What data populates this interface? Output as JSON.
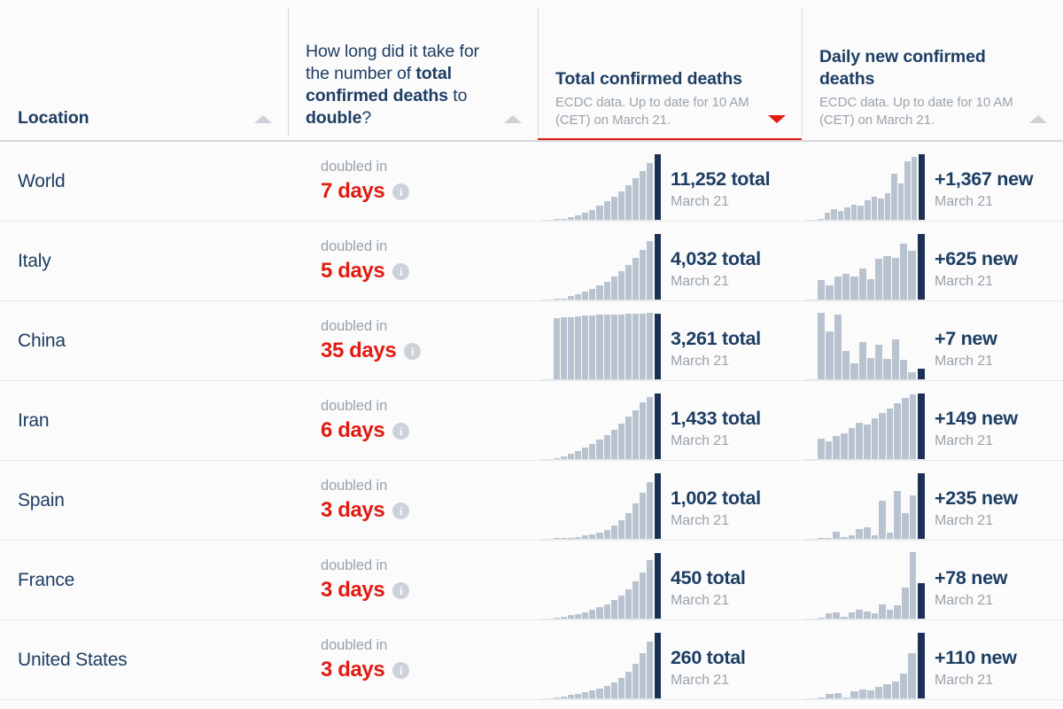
{
  "columns": {
    "location": {
      "label": "Location",
      "sort_icon": "triangle-up-icon",
      "sort_state": "inactive"
    },
    "doubling": {
      "title_parts": [
        "How long did it take for ",
        "the number of ",
        "total confirmed deaths",
        " to ",
        "double",
        "?"
      ],
      "title_plain": "How long did it take for the number of total confirmed deaths to double?",
      "sort_icon": "triangle-up-icon",
      "sort_state": "inactive"
    },
    "total_deaths": {
      "title": "Total confirmed deaths",
      "subtitle": "ECDC data. Up to date for 10 AM (CET) on March 21.",
      "sort_icon": "triangle-down-icon",
      "sort_state": "active-descending"
    },
    "daily_deaths": {
      "title": "Daily new confirmed deaths",
      "subtitle": "ECDC data. Up to date for 10 AM (CET) on March 21.",
      "sort_icon": "triangle-up-icon",
      "sort_state": "inactive"
    }
  },
  "labels": {
    "doubled_in": "doubled in",
    "info_glyph": "i"
  },
  "colors": {
    "accent_red": "#e01b12",
    "navy": "#1d3d63",
    "bar_light": "#b9c3cf",
    "bar_last": "#1d3154",
    "muted": "#9aa3ad",
    "background": "#fbfbfb"
  },
  "chart_data": {
    "type": "bar",
    "title": "Total confirmed deaths and Daily new confirmed deaths by location",
    "subtitle": "ECDC data. Up to date for 10 AM (CET) on March 21.",
    "xlabel": "",
    "ylabel": "",
    "legend": [],
    "grid": false,
    "note": "Each row contains two sparkline bar charts: cumulative total deaths and daily new deaths. The final (rightmost) bar of each sparkline is highlighted in dark navy and corresponds to the labelled value for March 21.",
    "rows": [
      {
        "location": "World",
        "doubling_label": "doubled in",
        "doubling_value": "7 days",
        "doubling_days": 7,
        "total": {
          "value_label": "11,252 total",
          "value": 11252,
          "date": "March 21",
          "series": [
            1,
            3,
            5,
            8,
            12,
            16,
            22,
            29,
            36,
            44,
            53,
            63,
            74,
            86,
            100
          ]
        },
        "daily": {
          "value_label": "+1,367 new",
          "value": 1367,
          "date": "March 21",
          "series": [
            3,
            12,
            17,
            14,
            20,
            24,
            23,
            30,
            35,
            33,
            41,
            70,
            55,
            88,
            95,
            100
          ]
        }
      },
      {
        "location": "Italy",
        "doubling_label": "doubled in",
        "doubling_value": "5 days",
        "doubling_days": 5,
        "total": {
          "value_label": "4,032 total",
          "value": 4032,
          "date": "March 21",
          "series": [
            1,
            3,
            6,
            9,
            13,
            17,
            22,
            28,
            35,
            43,
            52,
            63,
            75,
            88,
            100
          ]
        },
        "daily": {
          "value_label": "+625 new",
          "value": 625,
          "date": "March 21",
          "series": [
            30,
            22,
            35,
            40,
            36,
            48,
            32,
            62,
            66,
            63,
            84,
            74,
            100
          ]
        }
      },
      {
        "location": "China",
        "doubling_label": "doubled in",
        "doubling_value": "35 days",
        "doubling_days": 35,
        "total": {
          "value_label": "3,261 total",
          "value": 3261,
          "date": "March 21",
          "series": [
            92,
            93,
            94,
            95,
            96,
            96,
            97,
            97,
            98,
            98,
            99,
            99,
            99,
            100,
            100
          ]
        },
        "daily": {
          "value_label": "+7 new",
          "value": 7,
          "date": "March 21",
          "series": [
            100,
            72,
            98,
            44,
            25,
            57,
            33,
            52,
            32,
            60,
            30,
            12,
            18
          ]
        }
      },
      {
        "location": "Iran",
        "doubling_label": "doubled in",
        "doubling_value": "6 days",
        "doubling_days": 6,
        "total": {
          "value_label": "1,433 total",
          "value": 1433,
          "date": "March 21",
          "series": [
            2,
            5,
            9,
            13,
            18,
            24,
            30,
            37,
            45,
            54,
            64,
            74,
            85,
            93,
            100
          ]
        },
        "daily": {
          "value_label": "+149 new",
          "value": 149,
          "date": "March 21",
          "series": [
            32,
            28,
            36,
            40,
            48,
            55,
            52,
            62,
            70,
            76,
            84,
            92,
            98,
            100
          ]
        }
      },
      {
        "location": "Spain",
        "doubling_label": "doubled in",
        "doubling_value": "3 days",
        "doubling_days": 3,
        "total": {
          "value_label": "1,002 total",
          "value": 1002,
          "date": "March 21",
          "series": [
            1,
            2,
            3,
            4,
            6,
            8,
            11,
            15,
            21,
            29,
            40,
            54,
            70,
            86,
            100
          ]
        },
        "daily": {
          "value_label": "+235 new",
          "value": 235,
          "date": "March 21",
          "series": [
            2,
            3,
            12,
            4,
            6,
            16,
            18,
            7,
            58,
            10,
            72,
            40,
            66,
            100
          ]
        }
      },
      {
        "location": "France",
        "doubling_label": "doubled in",
        "doubling_value": "3 days",
        "doubling_days": 3,
        "total": {
          "value_label": "450 total",
          "value": 450,
          "date": "March 21",
          "series": [
            2,
            4,
            6,
            8,
            11,
            14,
            18,
            23,
            29,
            36,
            45,
            56,
            70,
            88,
            100
          ]
        },
        "daily": {
          "value_label": "+78 new",
          "value": 78,
          "date": "March 21",
          "series": [
            3,
            9,
            10,
            4,
            11,
            14,
            12,
            9,
            22,
            15,
            21,
            47,
            100,
            55
          ]
        }
      },
      {
        "location": "United States",
        "doubling_label": "doubled in",
        "doubling_value": "3 days",
        "doubling_days": 3,
        "total": {
          "value_label": "260 total",
          "value": 260,
          "date": "March 21",
          "series": [
            2,
            4,
            6,
            8,
            10,
            13,
            16,
            20,
            25,
            32,
            41,
            53,
            68,
            86,
            100
          ]
        },
        "daily": {
          "value_label": "+110 new",
          "value": 110,
          "date": "March 21",
          "series": [
            3,
            8,
            9,
            3,
            12,
            14,
            13,
            18,
            22,
            26,
            38,
            68,
            100
          ]
        }
      }
    ]
  }
}
